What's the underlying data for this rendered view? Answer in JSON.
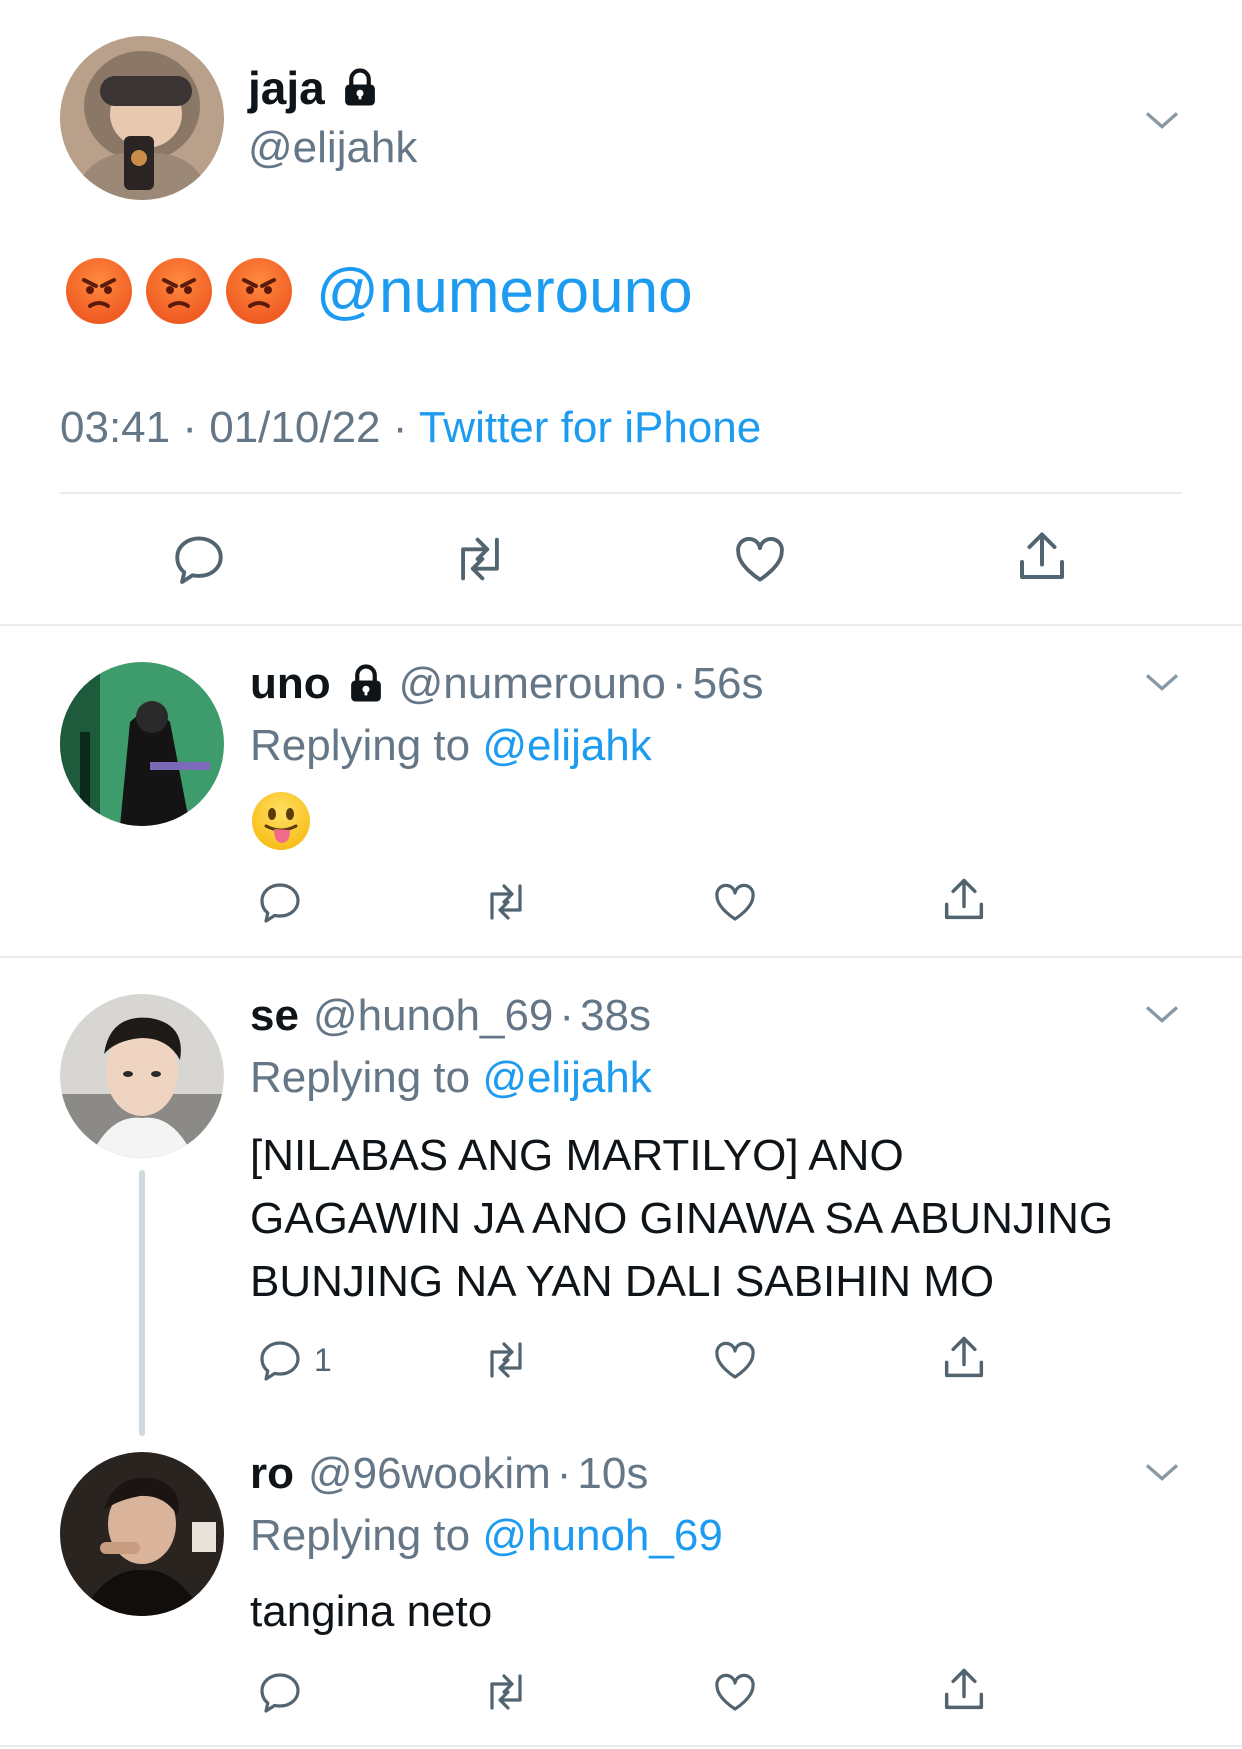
{
  "main_tweet": {
    "display_name": "jaja",
    "handle": "@elijahk",
    "text_mention": "@numerouno",
    "emojis": [
      "angry-face",
      "angry-face",
      "angry-face"
    ],
    "time": "03:41",
    "date": "01/10/22",
    "source": "Twitter for iPhone",
    "separator": "·"
  },
  "replies": [
    {
      "display_name": "uno",
      "locked": true,
      "handle": "@numerouno",
      "time": "56s",
      "replying_label": "Replying to",
      "replying_to": "@elijahk",
      "text": "",
      "emoji": "face-with-tongue",
      "reply_count": ""
    },
    {
      "display_name": "se",
      "locked": false,
      "handle": "@hunoh_69",
      "time": "38s",
      "replying_label": "Replying to",
      "replying_to": "@elijahk",
      "text_lines": [
        "[NILABAS ANG MARTILYO] ANO",
        "GAGAWIN JA ANO GINAWA SA ABUNJING",
        "BUNJING NA YAN DALI SABIHIN MO"
      ],
      "reply_count": "1"
    },
    {
      "display_name": "ro",
      "locked": false,
      "handle": "@96wookim",
      "time": "10s",
      "replying_label": "Replying to",
      "replying_to": "@hunoh_69",
      "text": "tangina neto",
      "reply_count": ""
    }
  ],
  "colors": {
    "link": "#1d9bf0",
    "secondary_text": "#657786",
    "divider": "#e6ecf0",
    "icon": "#536471"
  }
}
